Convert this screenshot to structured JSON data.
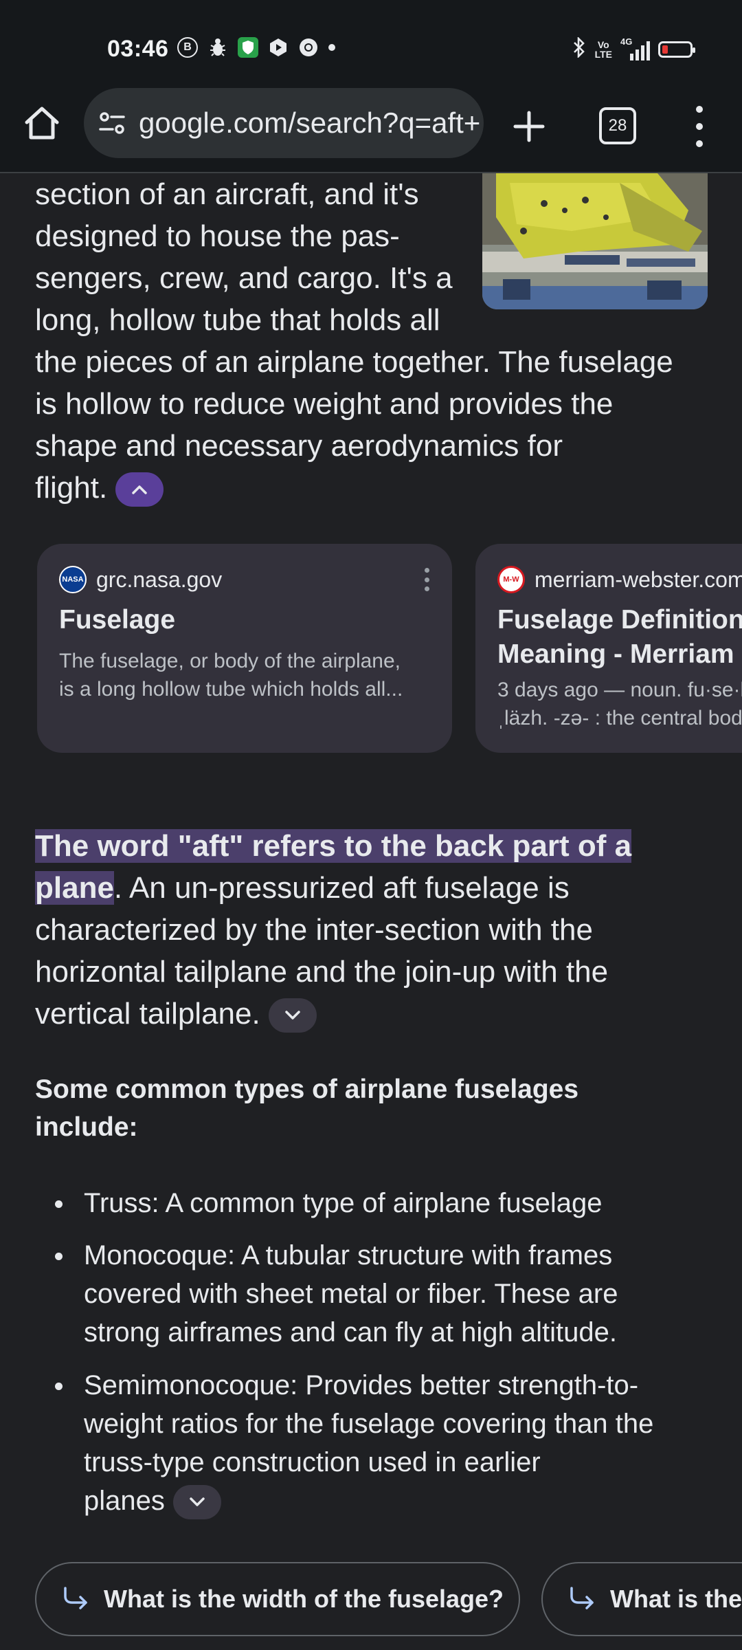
{
  "status_bar": {
    "time": "03:46",
    "left_icons": [
      "b-circle-icon",
      "bug-icon",
      "shield-icon",
      "play-icon",
      "chrome-icon",
      "dot-icon"
    ],
    "right_icons": [
      "bluetooth-icon",
      "volte-icon",
      "signal-4g-icon",
      "battery-icon"
    ],
    "volte_label_top": "Vo",
    "volte_label_bottom": "LTE",
    "network_label": "4G",
    "battery_level": 0.2
  },
  "toolbar": {
    "url": "google.com/search?q=aft+",
    "tab_count": "28"
  },
  "intro": {
    "lines": [
      "section of an aircraft, and it's",
      "designed to house the pas-",
      "sengers, crew, and cargo. It's a",
      "long, hollow tube that holds all",
      "the pieces of an airplane together. The fuselage",
      "is hollow to reduce weight and provides the",
      "shape and necessary aerodynamics for",
      "flight."
    ]
  },
  "source_cards": [
    {
      "domain": "grc.nasa.gov",
      "favicon_text": "NASA",
      "title_lines": [
        "Fuselage"
      ],
      "snippet_lines": [
        "The fuselage, or body of the airplane,",
        "is a long hollow tube which holds all..."
      ]
    },
    {
      "domain": "merriam-webster.com",
      "favicon_text": "M-W",
      "title_lines": [
        "Fuselage Definition",
        "Meaning - Merriam"
      ],
      "snippet_lines": [
        "3 days ago — noun. fu·se·l",
        "ˌläzh. -zə- : the central bod"
      ]
    }
  ],
  "aft": {
    "highlight_line1": "The word \"aft\" refers to the back part of a",
    "highlight_line2": "plane",
    "rest_line2": ". An un-pressurized aft fuselage is",
    "lines": [
      "characterized by the inter-section with the",
      "horizontal tailplane and the join-up with the",
      "vertical tailplane."
    ]
  },
  "types": {
    "heading_lines": [
      "Some common types of airplane fuselages",
      "include:"
    ],
    "items": [
      {
        "lines": [
          "Truss: A common type of airplane fuselage"
        ]
      },
      {
        "lines": [
          "Monocoque: A tubular structure with frames",
          "covered with sheet metal or fiber. These are",
          "strong airframes and can fly at high altitude."
        ]
      },
      {
        "lines": [
          "Semimonocoque: Provides better strength-to-",
          "weight ratios for the fuselage covering than the",
          "truss-type construction used in earlier",
          "planes"
        ]
      }
    ]
  },
  "suggestions": [
    "What is the width of the fuselage?",
    "What is the"
  ],
  "colors": {
    "background": "#1f2023",
    "highlight": "#4b3f6b",
    "collapse_chip": "#5a3f9a",
    "card": "#33313b",
    "battery_low": "#e53935"
  }
}
